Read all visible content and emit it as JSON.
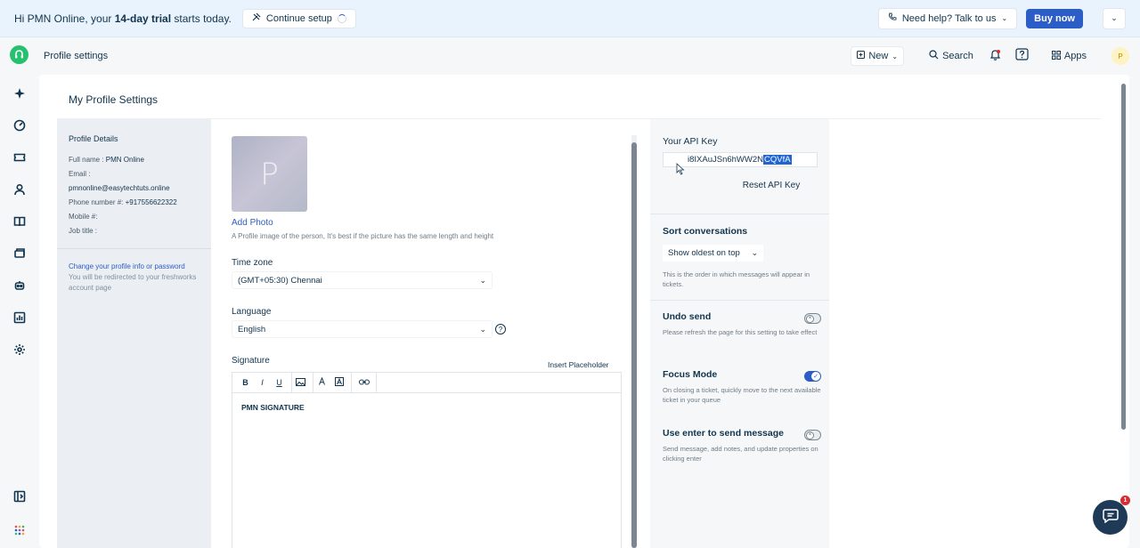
{
  "banner": {
    "greeting_prefix": "Hi PMN Online, your ",
    "trial_bold": "14-day trial",
    "greeting_suffix": " starts today.",
    "continue_setup": "Continue setup",
    "help": "Need help? Talk to us",
    "buy_now": "Buy now"
  },
  "header": {
    "page_title": "Profile settings",
    "new_label": "New",
    "search_label": "Search",
    "apps_label": "Apps",
    "avatar_initial": "P"
  },
  "main": {
    "title": "My Profile Settings"
  },
  "profile_details": {
    "heading": "Profile Details",
    "full_name_label": "Full name : ",
    "full_name": "PMN Online",
    "email_label": "Email :",
    "email": "pmnonline@easytechtuts.online",
    "phone_label": "Phone number #: ",
    "phone": "+917556622322",
    "mobile_label": "Mobile #:",
    "job_title_label": "Job title :",
    "change_link": "Change your profile info or password",
    "redirect_note": "You will be redirected to your freshworks account page"
  },
  "form": {
    "photo_initial": "P",
    "add_photo": "Add Photo",
    "photo_hint": "A Profile image of the person, It's best if the picture has the same length and height",
    "timezone_label": "Time zone",
    "timezone_value": "(GMT+05:30) Chennai",
    "language_label": "Language",
    "language_value": "English",
    "signature_label": "Signature",
    "insert_placeholder": "Insert Placeholder",
    "toolbar": [
      "B",
      "I",
      "U"
    ],
    "signature_text": "PMN SIGNATURE"
  },
  "settings": {
    "api_key_label": "Your API Key",
    "api_key_plain": "i8IXAuJSn6hWW2N",
    "api_key_selected": "CQVfA",
    "reset_api_key": "Reset API Key",
    "sort_label": "Sort conversations",
    "sort_value": "Show oldest on top",
    "sort_desc": "This is the order in which messages will appear in tickets.",
    "undo_label": "Undo send",
    "undo_desc": "Please refresh the page for this setting to take effect",
    "undo_enabled": false,
    "focus_label": "Focus Mode",
    "focus_desc": "On closing a ticket, quickly move to the next available ticket in your queue",
    "focus_enabled": true,
    "enter_label": "Use enter to send message",
    "enter_desc": "Send message, add notes, and update properties on clicking enter",
    "enter_enabled": false
  },
  "chat": {
    "badge_count": "1"
  },
  "colors": {
    "accent": "#2c5cc5",
    "banner_bg": "#e8f3fe",
    "logo_green": "#25c16f",
    "chat_bg": "#1e3a56",
    "badge_red": "#d72d30"
  },
  "icons": {
    "rail": [
      "sparkle-icon",
      "dashboard-icon",
      "tickets-icon",
      "contacts-icon",
      "knowledge-base-icon",
      "inbox-icon",
      "bot-icon",
      "reports-icon",
      "admin-gear-icon",
      "collapse-sidebar-icon",
      "apps-grid-icon"
    ]
  }
}
